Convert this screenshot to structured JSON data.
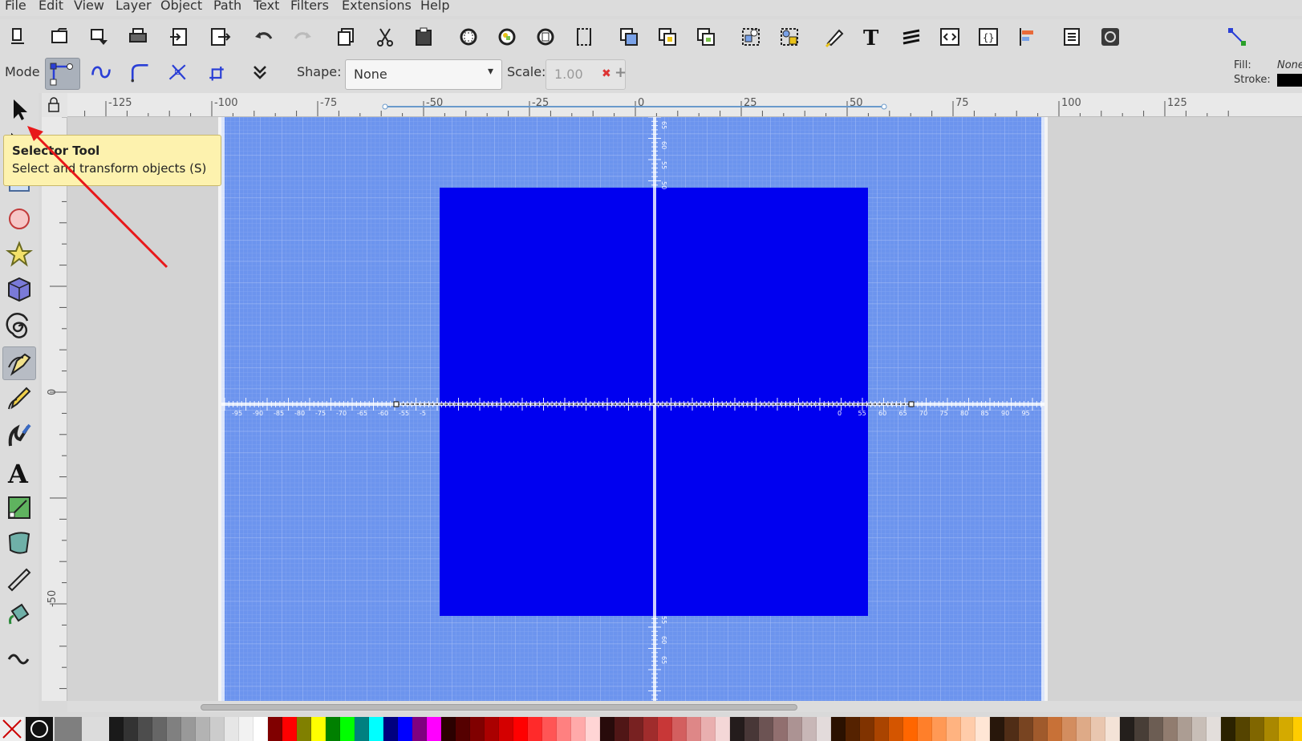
{
  "menu": [
    "File",
    "Edit",
    "View",
    "Layer",
    "Object",
    "Path",
    "Text",
    "Filters",
    "Extensions",
    "Help"
  ],
  "commands": [
    "new-document-icon",
    "open-icon",
    "open-recent-icon",
    "print-icon",
    "import-icon",
    "export-icon",
    "undo-icon",
    "redo-icon",
    "copy-icon",
    "cut-icon",
    "paste-icon",
    "zoom-selection-icon",
    "zoom-drawing-icon",
    "zoom-page-icon",
    "zoom-page-width-icon",
    "duplicate-icon",
    "clone-icon",
    "unlink-clone-icon",
    "group-icon",
    "ungroup-icon",
    "fill-stroke-icon",
    "text-font-icon",
    "layers-icon",
    "xml-editor-icon",
    "object-properties-icon",
    "align-distribute-icon",
    "preferences-icon",
    "document-properties-icon",
    "snap-toggle-icon"
  ],
  "controls": {
    "mode_label": "Mode",
    "shape_label": "Shape:",
    "shape_value": "None",
    "scale_label": "Scale:",
    "scale_value": "1.00",
    "fill_label": "Fill:",
    "fill_value": "None",
    "stroke_label": "Stroke:",
    "stroke_color": "#000000"
  },
  "tools": [
    "selector-tool-icon",
    "node-tool-icon",
    "rectangle-tool-icon",
    "ellipse-tool-icon",
    "star-tool-icon",
    "3d-box-tool-icon",
    "spiral-tool-icon",
    "pen-tool-icon",
    "pencil-tool-icon",
    "calligraphy-tool-icon",
    "text-tool-icon",
    "gradient-tool-icon",
    "mesh-tool-icon",
    "dropper-tool-icon",
    "paint-bucket-tool-icon",
    "tweak-tool-icon"
  ],
  "active_tool": "pen-tool-icon",
  "tooltip": {
    "title": "Selector Tool",
    "description": "Select and transform objects (S)"
  },
  "rulers": {
    "h_labels": [
      "-125",
      "-100",
      "-75",
      "-50",
      "-25",
      "0",
      "25",
      "50",
      "75",
      "100",
      "125"
    ],
    "v_labels": [
      "50",
      "0",
      "-50"
    ]
  },
  "canvas": {
    "page_color": "#6c94ee",
    "rect_color": "#0000f0",
    "desk_color": "#d3d3d3",
    "axis_labels_left": [
      "-95",
      "-90",
      "-85",
      "-80",
      "-75",
      "-70",
      "-65",
      "-60",
      "-55",
      "-5"
    ],
    "axis_labels_right": [
      "0",
      "55",
      "60",
      "65",
      "70",
      "75",
      "80",
      "85",
      "90",
      "95"
    ],
    "axis_labels_top": [
      "65",
      "60",
      "55",
      "50"
    ],
    "axis_labels_bottom": [
      "55",
      "60",
      "65"
    ]
  },
  "palette": [
    "#1a1a1a",
    "#333333",
    "#4d4d4d",
    "#666666",
    "#808080",
    "#999999",
    "#b3b3b3",
    "#cccccc",
    "#e6e6e6",
    "#f2f2f2",
    "#ffffff",
    "#800000",
    "#ff0000",
    "#808000",
    "#ffff00",
    "#008000",
    "#00ff00",
    "#008080",
    "#00ffff",
    "#000080",
    "#0000ff",
    "#800080",
    "#ff00ff",
    "#2b0000",
    "#550000",
    "#800000",
    "#aa0000",
    "#d40000",
    "#ff0000",
    "#ff2a2a",
    "#ff5555",
    "#ff8080",
    "#ffaaaa",
    "#ffd5d5",
    "#280b0b",
    "#501616",
    "#782121",
    "#a02c2c",
    "#c83737",
    "#d35f5f",
    "#de8787",
    "#e9afaf",
    "#f4d7d7",
    "#241c1c",
    "#483737",
    "#6c5353",
    "#916f6f",
    "#ac9393",
    "#c8b7b7",
    "#e3dbdb",
    "#2b1100",
    "#552200",
    "#803300",
    "#aa4400",
    "#d45500",
    "#ff6600",
    "#ff7f2a",
    "#ff9955",
    "#ffb380",
    "#ffccaa",
    "#ffe6d5",
    "#28170b",
    "#502d16",
    "#784421",
    "#a05a2c",
    "#c87137",
    "#d38d5f",
    "#deaa87",
    "#e9c6af",
    "#f4e3d7",
    "#241f1c",
    "#483e37",
    "#6c5d53",
    "#917c6f",
    "#ac9d93",
    "#c8beb7",
    "#e3dedb",
    "#2b2200",
    "#554400",
    "#806600",
    "#aa8800",
    "#d4aa00",
    "#ffcc00",
    "#ffdd55",
    "#ffe680",
    "#fff6d5",
    "#1c241c",
    "#374837",
    "#536c53",
    "#6f916f",
    "#93ac93",
    "#b7c8b7",
    "#0b280b",
    "#165016",
    "#217821",
    "#2ca02c",
    "#37c837",
    "#5fd35f",
    "#87de87",
    "#afe9af"
  ]
}
